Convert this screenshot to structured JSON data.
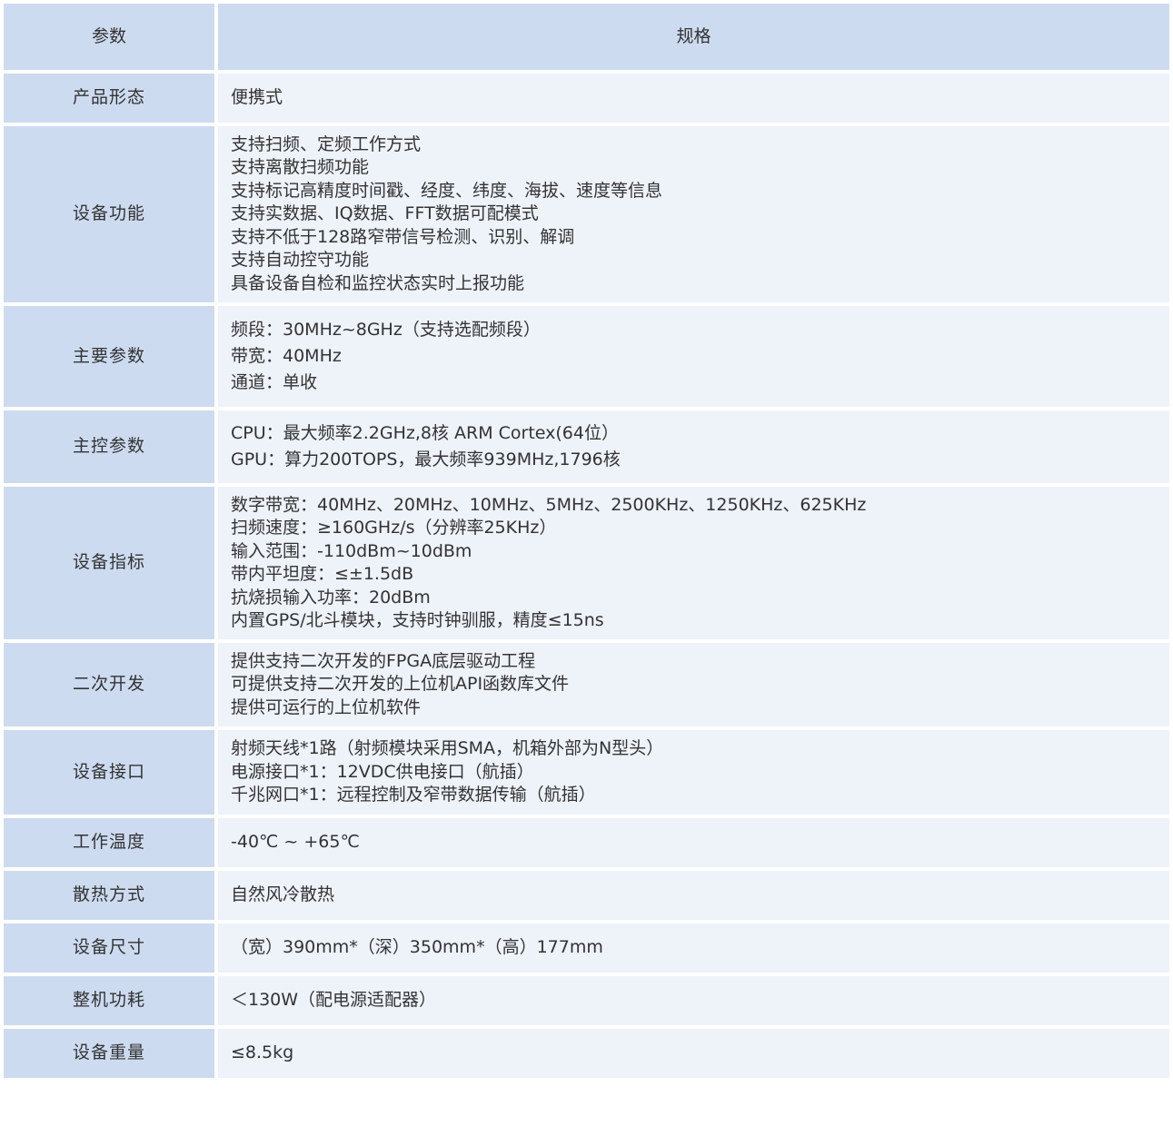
{
  "header": {
    "param": "参数",
    "spec": "规格"
  },
  "rows": [
    {
      "label": "产品形态",
      "values": [
        "便携式"
      ]
    },
    {
      "label": "设备功能",
      "values": [
        "支持扫频、定频工作方式",
        "支持离散扫频功能",
        "支持标记高精度时间戳、经度、纬度、海拔、速度等信息",
        "支持实数据、IQ数据、FFT数据可配模式",
        "支持不低于128路窄带信号检测、识别、解调",
        "支持自动控守功能",
        "具备设备自检和监控状态实时上报功能"
      ]
    },
    {
      "label": "主要参数",
      "values": [
        "频段：30MHz~8GHz（支持选配频段）",
        "带宽：40MHz",
        "通道：单收"
      ]
    },
    {
      "label": "主控参数",
      "values": [
        "CPU：最大频率2.2GHz,8核 ARM Cortex(64位）",
        "GPU：算力200TOPS，最大频率939MHz,1796核"
      ]
    },
    {
      "label": "设备指标",
      "values": [
        "数字带宽：40MHz、20MHz、10MHz、5MHz、2500KHz、1250KHz、625KHz",
        "扫频速度：≥160GHz/s（分辨率25KHz）",
        "输入范围：-110dBm~10dBm",
        "带内平坦度：≤±1.5dB",
        "抗烧损输入功率：20dBm",
        "内置GPS/北斗模块，支持时钟驯服，精度≤15ns"
      ]
    },
    {
      "label": "二次开发",
      "values": [
        "提供支持二次开发的FPGA底层驱动工程",
        "可提供支持二次开发的上位机API函数库文件",
        "提供可运行的上位机软件"
      ]
    },
    {
      "label": "设备接口",
      "values": [
        "射频天线*1路（射频模块采用SMA，机箱外部为N型头）",
        "电源接口*1：12VDC供电接口（航插）",
        "千兆网口*1：远程控制及窄带数据传输（航插）"
      ]
    },
    {
      "label": "工作温度",
      "values": [
        "-40℃ ~ +65℃"
      ]
    },
    {
      "label": "散热方式",
      "values": [
        "自然风冷散热"
      ]
    },
    {
      "label": "设备尺寸",
      "values": [
        "（宽）390mm*（深）350mm*（高）177mm"
      ]
    },
    {
      "label": "整机功耗",
      "values": [
        "＜130W（配电源适配器）"
      ]
    },
    {
      "label": "设备重量",
      "values": [
        "≤8.5kg"
      ]
    }
  ]
}
